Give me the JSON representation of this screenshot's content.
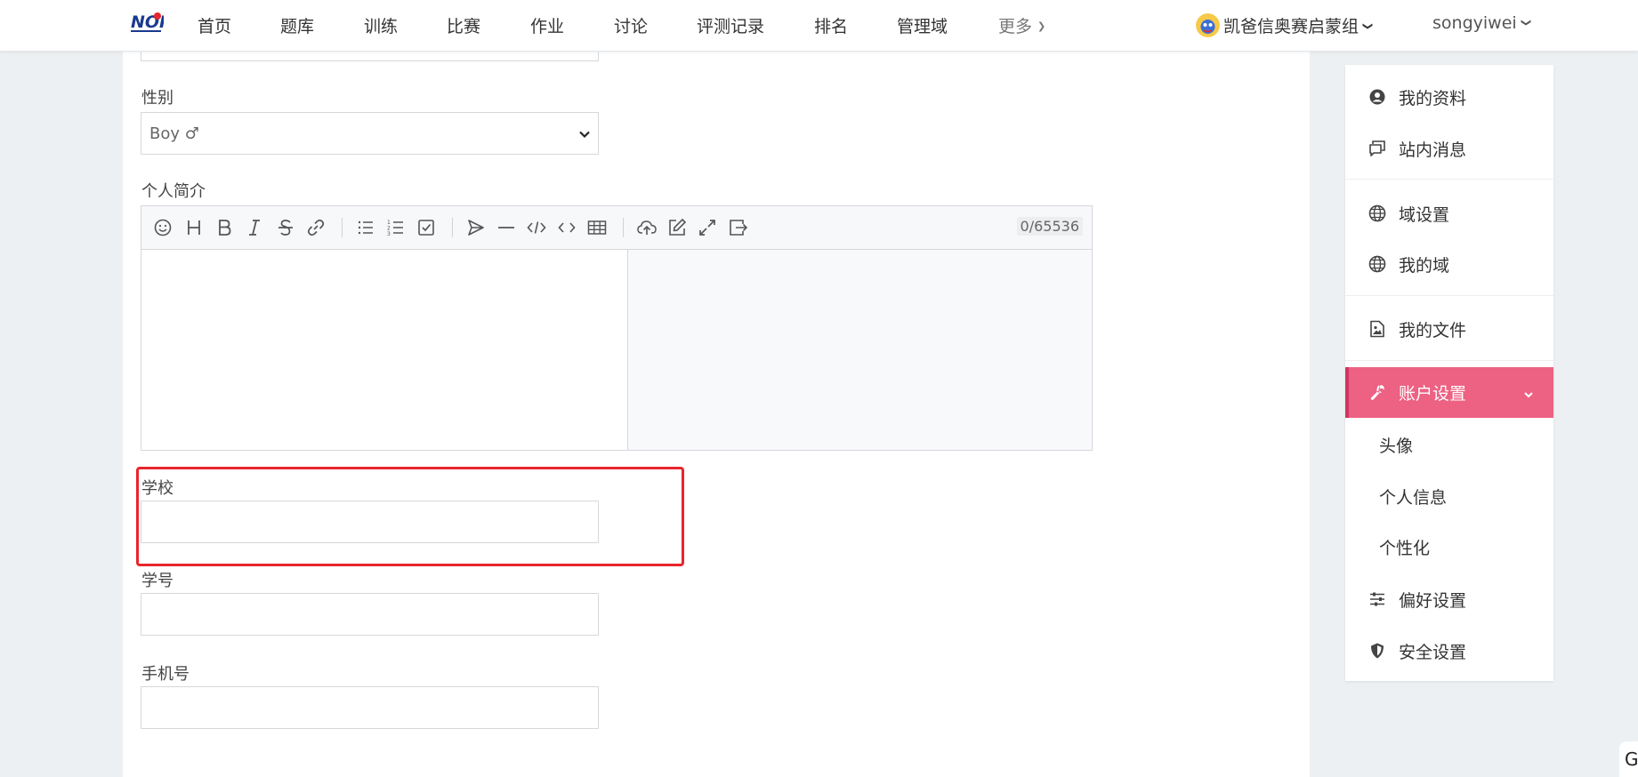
{
  "nav": {
    "items": [
      {
        "label": "首页"
      },
      {
        "label": "题库"
      },
      {
        "label": "训练"
      },
      {
        "label": "比赛"
      },
      {
        "label": "作业"
      },
      {
        "label": "讨论"
      },
      {
        "label": "评测记录"
      },
      {
        "label": "排名"
      },
      {
        "label": "管理域"
      }
    ],
    "more_label": "更多",
    "domain_label": "凯爸信奥赛启蒙组",
    "username": "songyiwei",
    "logo_icon": "noi-logo-icon"
  },
  "form": {
    "gender_label": "性别",
    "gender_value": "Boy ♂",
    "bio_label": "个人简介",
    "bio_counter": "0/65536",
    "school_label": "学校",
    "school_value": "",
    "student_id_label": "学号",
    "student_id_value": "",
    "phone_label": "手机号",
    "phone_value": ""
  },
  "editor_toolbar": [
    "emoji-icon",
    "heading-icon",
    "bold-icon",
    "italic-icon",
    "strikethrough-icon",
    "link-icon",
    "unordered-list-icon",
    "ordered-list-icon",
    "checklist-icon",
    "quote-icon",
    "horizontal-rule-icon",
    "code-block-icon",
    "inline-code-icon",
    "table-icon",
    "upload-icon",
    "edit-mode-icon",
    "fullscreen-icon",
    "exit-icon"
  ],
  "sidebar": {
    "items": [
      {
        "label": "我的资料",
        "icon": "user-circle-icon"
      },
      {
        "label": "站内消息",
        "icon": "messages-icon"
      },
      {
        "label": "域设置",
        "icon": "globe-icon"
      },
      {
        "label": "我的域",
        "icon": "globe-icon"
      },
      {
        "label": "我的文件",
        "icon": "file-image-icon"
      },
      {
        "label": "账户设置",
        "icon": "wrench-icon"
      },
      {
        "label": "偏好设置",
        "icon": "sliders-icon"
      },
      {
        "label": "安全设置",
        "icon": "shield-icon"
      }
    ],
    "account_subitems": [
      {
        "label": "头像"
      },
      {
        "label": "个人信息"
      },
      {
        "label": "个性化"
      }
    ],
    "active_color": "#ed6183"
  },
  "colors": {
    "accent": "#ed6183",
    "highlight": "#e8262b",
    "background": "#edf0f2"
  },
  "corner_glyph": "G"
}
